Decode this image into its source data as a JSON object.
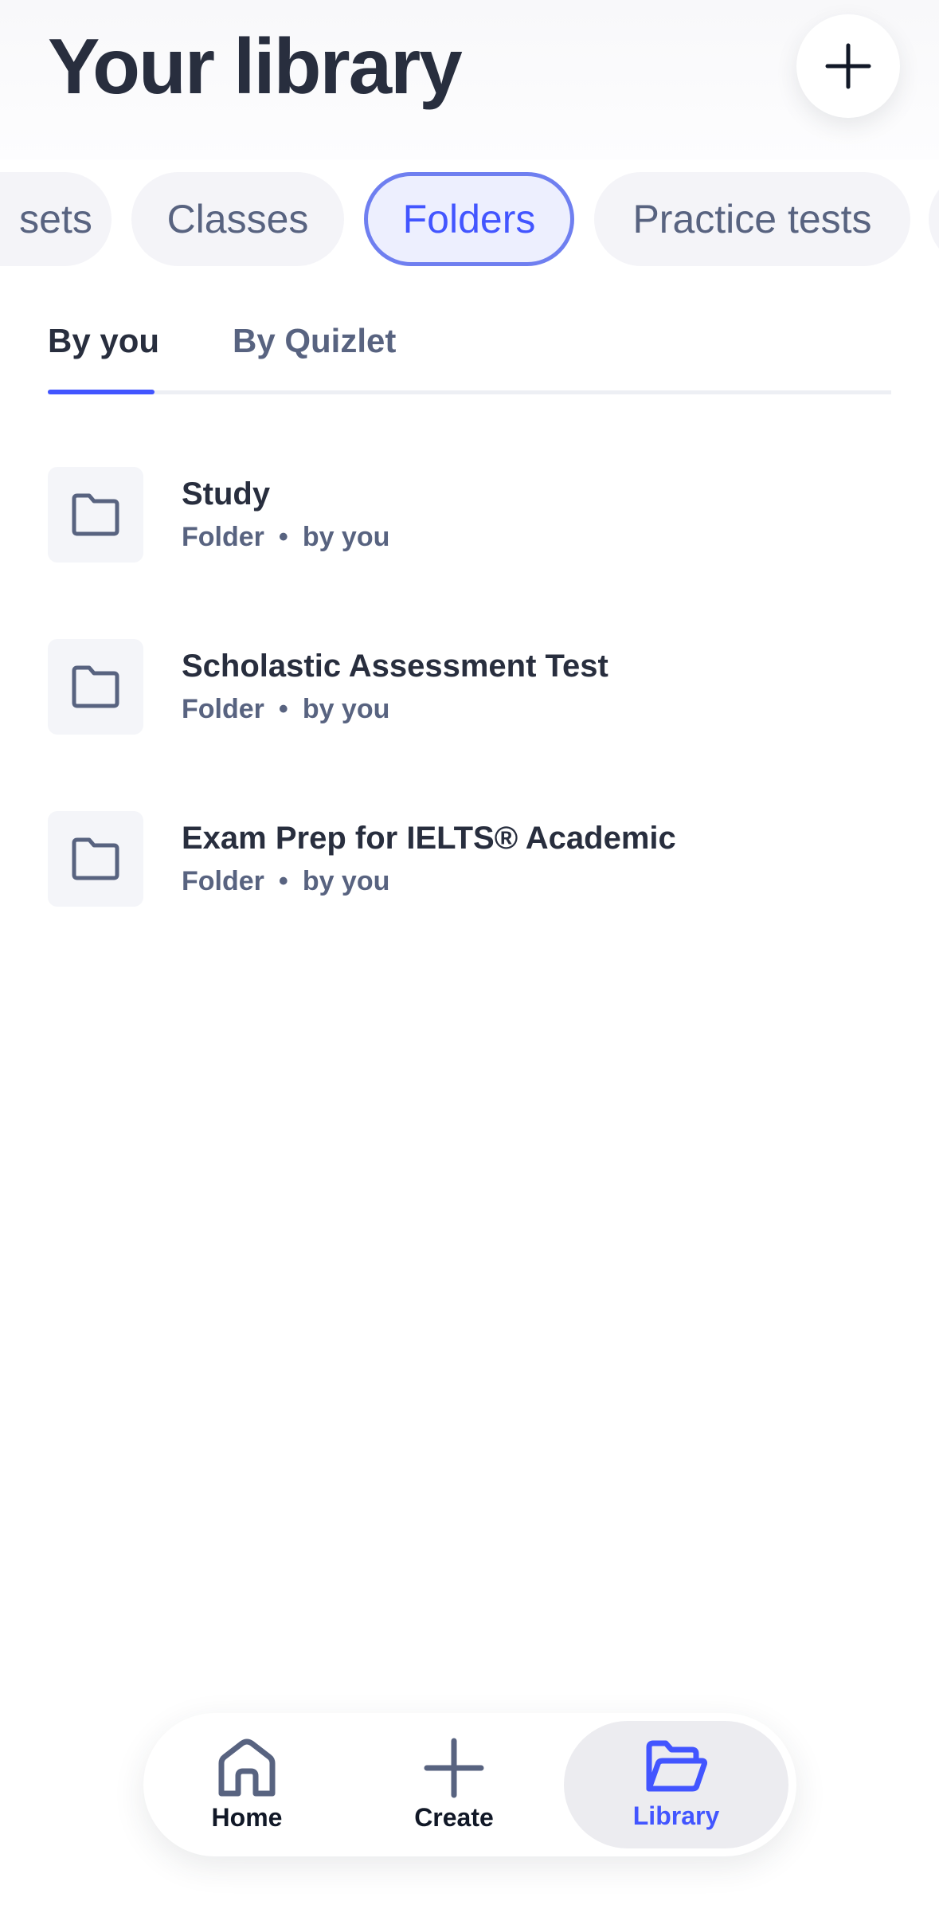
{
  "header": {
    "title": "Your library"
  },
  "filters": [
    {
      "label": "sets",
      "active": false
    },
    {
      "label": "Classes",
      "active": false
    },
    {
      "label": "Folders",
      "active": true
    },
    {
      "label": "Practice tests",
      "active": false
    }
  ],
  "tabs": [
    {
      "label": "By you",
      "active": true
    },
    {
      "label": "By Quizlet",
      "active": false
    }
  ],
  "folders": [
    {
      "title": "Study",
      "type": "Folder",
      "separator": "•",
      "owner": "by you",
      "icon": "folder-icon"
    },
    {
      "title": "Scholastic Assessment Test",
      "type": "Folder",
      "separator": "•",
      "owner": "by you",
      "icon": "folder-icon"
    },
    {
      "title": "Exam Prep for IELTS® Academic",
      "type": "Folder",
      "separator": "•",
      "owner": "by you",
      "icon": "folder-icon"
    }
  ],
  "bottom_nav": [
    {
      "label": "Home",
      "icon": "home-icon",
      "active": false
    },
    {
      "label": "Create",
      "icon": "plus-icon",
      "active": false
    },
    {
      "label": "Library",
      "icon": "folder-open-icon",
      "active": true
    }
  ],
  "colors": {
    "accent": "#4255ff",
    "text_primary": "#282e3e",
    "text_secondary": "#586380",
    "chip_bg": "#f4f4f8"
  }
}
